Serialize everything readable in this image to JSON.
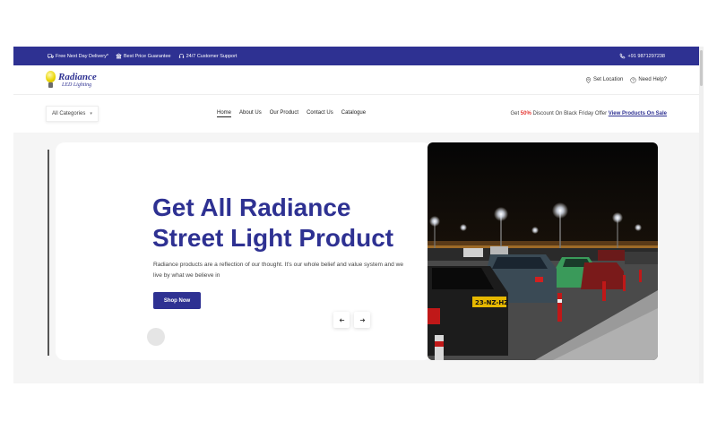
{
  "topbar": {
    "items": [
      {
        "icon": "truck-icon",
        "label": "Free Next Day Delivery*"
      },
      {
        "icon": "bank-icon",
        "label": "Best Price Guarantee"
      },
      {
        "icon": "headset-icon",
        "label": "24/7 Customer Support"
      }
    ],
    "phone": "+91 9871297238"
  },
  "header": {
    "brand": "Radiance",
    "brand_sub": "LED Lighting",
    "set_location": "Set Location",
    "need_help": "Need Help?"
  },
  "navbar": {
    "categories": "All Categories",
    "links": [
      "Home",
      "About Us",
      "Our Product",
      "Contact Us",
      "Catalogue"
    ],
    "offer_prefix": "Get",
    "offer_pct": "50%",
    "offer_middle": "Discount On Black Friday Offer",
    "offer_link": "View Products On Sale"
  },
  "hero": {
    "title_line1": "Get All Radiance",
    "title_line2": "Street Light Product",
    "description": "Radiance products are a reflection of our thought. It's our whole belief and value system and we live by what we believe in",
    "button": "Shop Now",
    "plate_text": "23-NZ-HZ"
  },
  "colors": {
    "primary": "#2e3192",
    "accent": "#e53935"
  }
}
